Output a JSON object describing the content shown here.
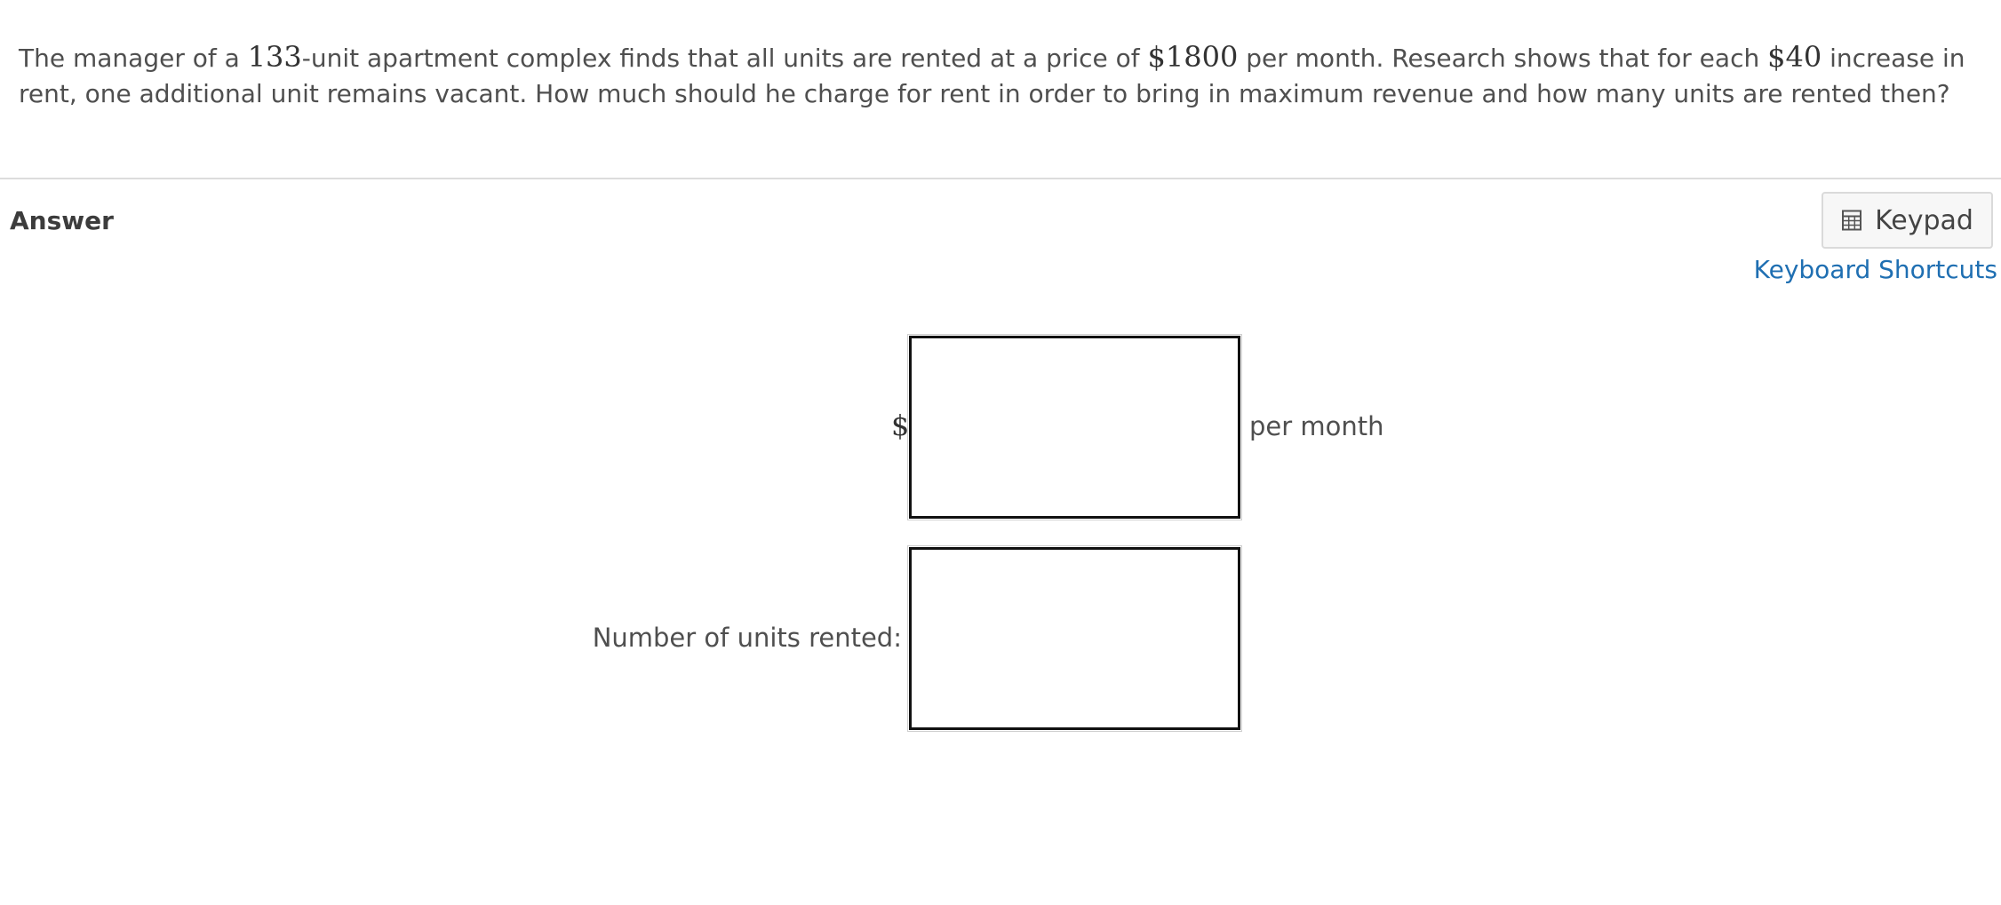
{
  "question": {
    "part1": "The manager of a ",
    "units_total": "133",
    "part2": "-unit apartment complex finds that all units are rented at a price of ",
    "price": "$1800",
    "part3": " per month. Research shows that for each ",
    "increase": "$40",
    "part4": " increase in rent, one additional unit remains vacant. How much should he charge for rent in order to bring in maximum revenue and how many units are rented then?"
  },
  "answer": {
    "heading": "Answer",
    "keypad_label": "Keypad",
    "keypad_icon": "calculator-icon",
    "shortcuts_label": "Keyboard Shortcuts",
    "price_prefix": "$",
    "price_suffix": "per month",
    "price_value": "",
    "units_label": "Number of units rented:",
    "units_value": ""
  }
}
